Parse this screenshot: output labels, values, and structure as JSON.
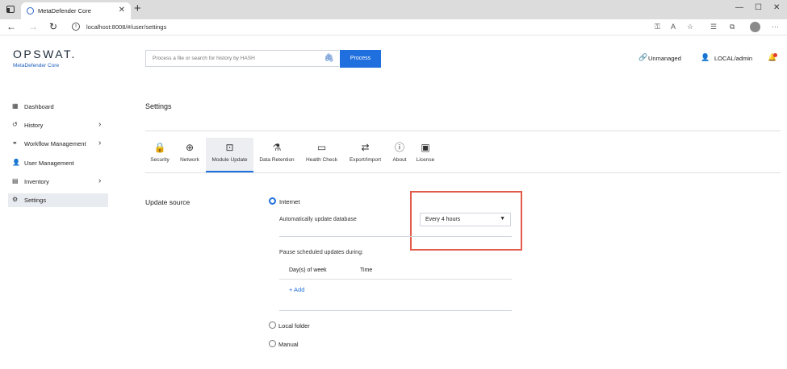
{
  "browser": {
    "tab_title": "MetaDefender Core",
    "tab_close": "✕",
    "new_tab": "+",
    "url": "localhost:8008/#/user/settings",
    "window_controls": [
      "—",
      "☐",
      "✕"
    ]
  },
  "header": {
    "logo_text": "OPSWAT.",
    "logo_sub": "MetaDefender Core",
    "search_placeholder": "Process a file or search for history by HASH",
    "process_label": "Process",
    "unmanaged_label": "Unmanaged",
    "user_label": "LOCAL/admin"
  },
  "sidebar": {
    "items": [
      {
        "label": "Dashboard",
        "icon": "dashboard-icon",
        "glyph": "▦",
        "chevron": ""
      },
      {
        "label": "History",
        "icon": "history-icon",
        "glyph": "↺",
        "chevron": "›"
      },
      {
        "label": "Workflow Management",
        "icon": "workflow-icon",
        "glyph": "⚭",
        "chevron": "›"
      },
      {
        "label": "User Management",
        "icon": "user-icon",
        "glyph": "👤",
        "chevron": ""
      },
      {
        "label": "Inventory",
        "icon": "inventory-icon",
        "glyph": "▤",
        "chevron": "›"
      },
      {
        "label": "Settings",
        "icon": "gear-icon",
        "glyph": "⚙",
        "chevron": ""
      }
    ]
  },
  "main": {
    "title": "Settings",
    "tabs": [
      {
        "label": "Security",
        "icon": "lock-icon",
        "glyph": "🔒"
      },
      {
        "label": "Network",
        "icon": "globe-icon",
        "glyph": "⊕"
      },
      {
        "label": "Module Update",
        "icon": "module-update-icon",
        "glyph": "⊡"
      },
      {
        "label": "Data Retention",
        "icon": "flask-icon",
        "glyph": "⚗"
      },
      {
        "label": "Health Check",
        "icon": "monitor-icon",
        "glyph": "▭"
      },
      {
        "label": "Export/Import",
        "icon": "swap-icon",
        "glyph": "⇄"
      },
      {
        "label": "About",
        "icon": "info-icon",
        "glyph": "ⓘ"
      },
      {
        "label": "License",
        "icon": "license-icon",
        "glyph": "▣"
      }
    ],
    "active_tab": "Module Update",
    "update_source": {
      "section_label": "Update source",
      "internet_label": "Internet",
      "auto_update_label": "Automatically update database",
      "frequency_value": "Every 4 hours",
      "pause_label": "Pause scheduled updates during:",
      "col_days": "Day(s) of week",
      "col_time": "Time",
      "add_label": "+ Add",
      "local_folder_label": "Local folder",
      "manual_label": "Manual",
      "selected": "Internet"
    }
  },
  "colors": {
    "accent": "#1f6fde",
    "highlight": "#e25a4a",
    "sidebar_active": "#e8ebef"
  }
}
